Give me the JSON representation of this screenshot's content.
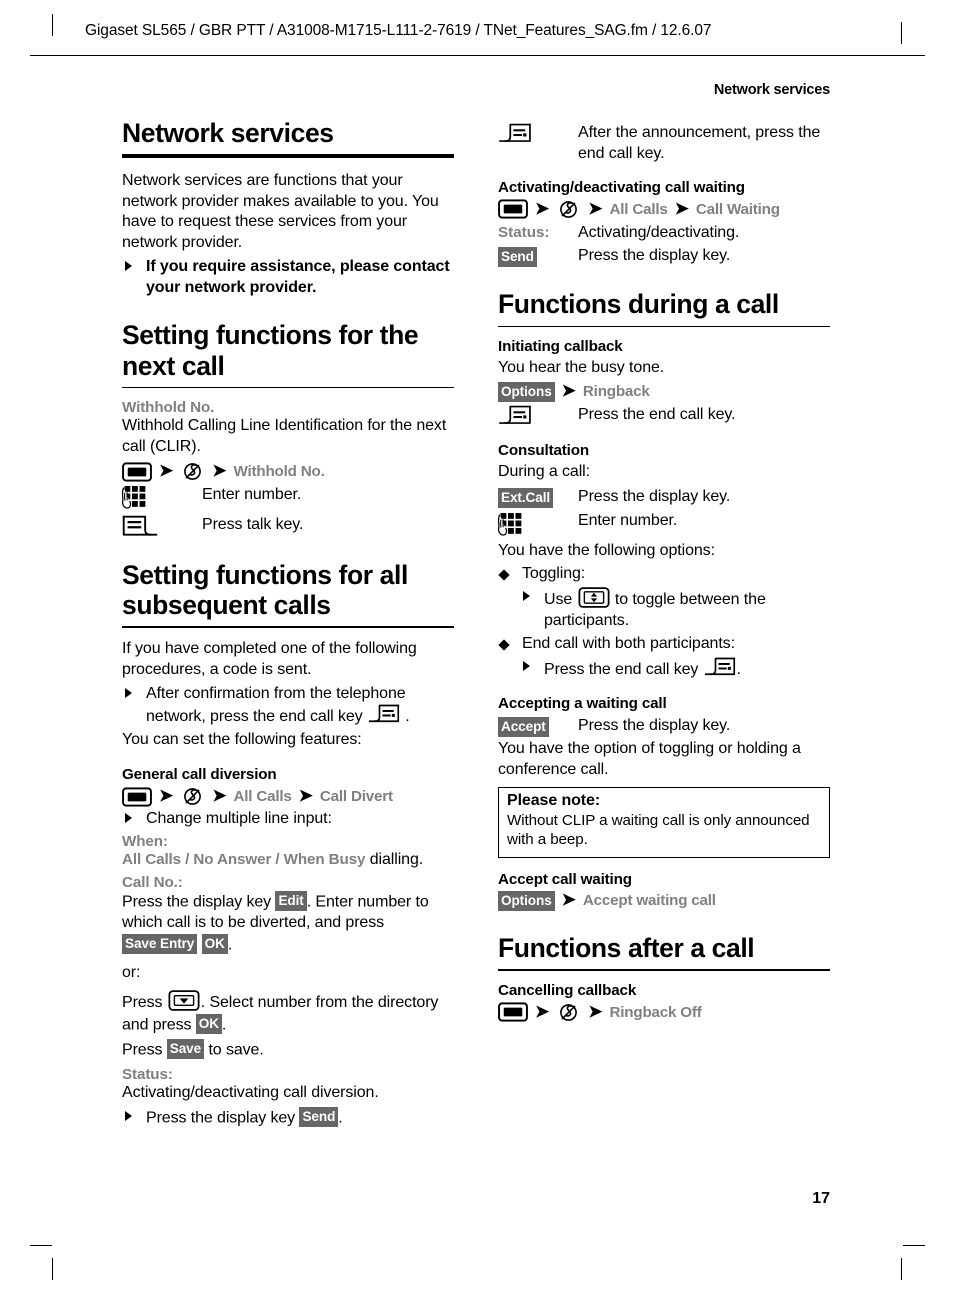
{
  "header": {
    "running_head": "Gigaset SL565 / GBR PTT / A31008-M1715-L111-2-7619 / TNet_Features_SAG.fm / 12.6.07",
    "chapter_tag": "Network services"
  },
  "page_number": "17",
  "left_column": {
    "title": "Network services",
    "intro": "Network services are functions that your network provider makes available to you. You have to request these services from your network provider.",
    "intro_bullet": "If you require assistance, please contact your network provider.",
    "section_next_call": {
      "title": "Setting functions for the next call",
      "term": "Withhold No.",
      "term_desc": "Withhold Calling Line Identification for the next call (CLIR).",
      "path": [
        "Withhold No."
      ],
      "row_keypad": "Enter number.",
      "row_talk": "Press talk key."
    },
    "section_all_calls": {
      "title": "Setting functions for all subsequent calls",
      "intro": "If you have completed one of the following procedures, a code is sent.",
      "bullet_before_icon": "After confirmation from the telephone network, press the end call key",
      "bullet_after_icon": ".",
      "features_line": "You can set the following features:",
      "subsection": {
        "title": "General call diversion",
        "path": [
          "All Calls",
          "Call Divert"
        ],
        "change_line": "Change multiple line input:",
        "when_label": "When:",
        "when_options": "All Calls / No Answer / When Busy",
        "when_suffix": " dialling.",
        "callno_label": "Call No.:",
        "callno_1a": "Press the display key ",
        "callno_key_edit": "Edit",
        "callno_1b": ". Enter number to which call is to be diverted, and press ",
        "callno_key_save_entry": "Save Entry",
        "callno_key_ok": "OK",
        "callno_1c": ".",
        "or_line": "or:",
        "callno_2a": "Press ",
        "callno_2b": ". Select number from the directory and press ",
        "callno_key_ok2": "OK",
        "callno_2c": ".",
        "callno_3a": "Press ",
        "callno_key_save": "Save",
        "callno_3b": " to save.",
        "status_label": "Status:",
        "status_desc": "Activating/deactivating call diversion.",
        "status_bullet_a": "Press the display key ",
        "status_key_send": "Send",
        "status_bullet_b": "."
      }
    }
  },
  "right_column": {
    "announcement_row": "After the announcement, press the end call key.",
    "section_call_waiting": {
      "title": "Activating/deactivating call waiting",
      "path": [
        "All Calls",
        "Call Waiting"
      ],
      "status_label": "Status:",
      "status_desc": "Activating/deactivating.",
      "send_key": "Send",
      "send_desc": "Press the display key."
    },
    "section_during_call": {
      "title": "Functions during a call",
      "callback": {
        "title": "Initiating callback",
        "busy_line": "You hear the busy tone.",
        "options_key": "Options",
        "options_target": "Ringback",
        "endcall_desc": "Press the end call key."
      },
      "consultation": {
        "title": "Consultation",
        "during_line": "During a call:",
        "extcall_key": "Ext.Call",
        "extcall_desc": "Press the display key.",
        "keypad_desc": "Enter number.",
        "options_line": "You have the following options:",
        "toggling_label": "Toggling:",
        "toggling_a": "Use ",
        "toggling_b": " to toggle between the participants.",
        "endboth_label": "End call with both participants:",
        "endboth_a": "Press the end call key ",
        "endboth_b": "."
      },
      "accepting": {
        "title": "Accepting a waiting call",
        "accept_key": "Accept",
        "accept_desc": "Press the display key.",
        "option_line": "You have the option of toggling or holding a conference call.",
        "note_title": "Please note:",
        "note_body": "Without CLIP a waiting call is only announced with a beep."
      },
      "accept_waiting": {
        "title": "Accept call waiting",
        "options_key": "Options",
        "options_target": "Accept waiting call"
      }
    },
    "section_after_call": {
      "title": "Functions after a call",
      "cancelling": {
        "title": "Cancelling callback",
        "path": [
          "Ringback Off"
        ]
      }
    }
  },
  "icons": {
    "menu_key": "menu-key-icon",
    "network_services": "network-services-icon",
    "keypad": "keypad-icon",
    "talk_key": "talk-key-icon",
    "end_call_key": "end-call-key-icon",
    "directory_key": "directory-down-key-icon",
    "toggle_key": "up-down-control-key-icon"
  },
  "colors": {
    "menu_label_gray": "#808080",
    "softkey_bg": "#666666",
    "text": "#000000"
  }
}
